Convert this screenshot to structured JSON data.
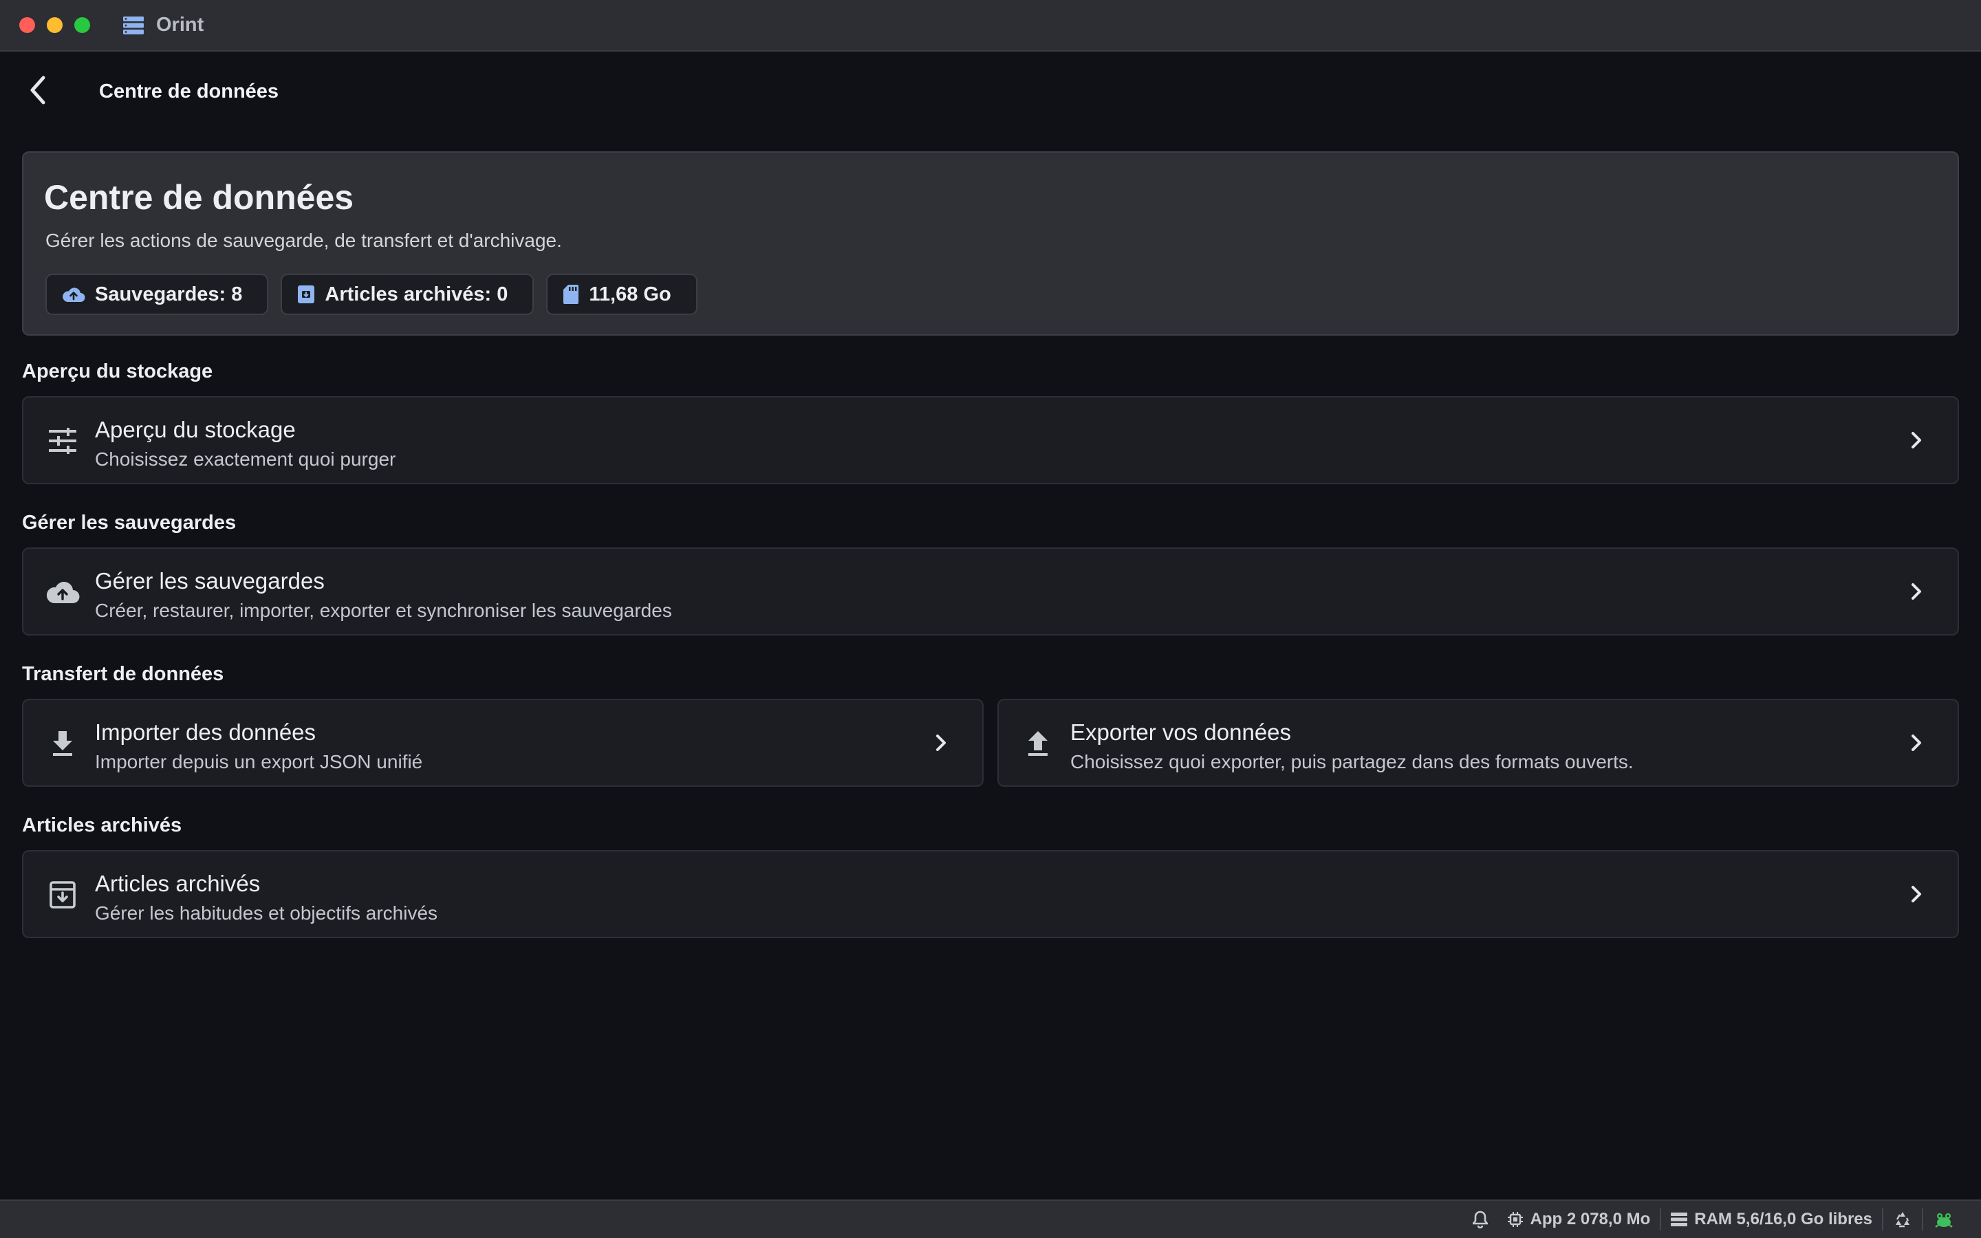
{
  "window": {
    "title": "Orint"
  },
  "nav": {
    "title": "Centre de données"
  },
  "hero": {
    "title": "Centre de données",
    "subtitle": "Gérer les actions de sauvegarde, de transfert et d'archivage.",
    "chips": [
      {
        "icon": "cloud-upload-icon",
        "label": "Sauvegardes: 8"
      },
      {
        "icon": "archive-box-icon",
        "label": "Articles archivés: 0"
      },
      {
        "icon": "sd-card-icon",
        "label": "11,68 Go"
      }
    ]
  },
  "sections": {
    "storage": {
      "label": "Aperçu du stockage",
      "card": {
        "icon": "sliders-icon",
        "title": "Aperçu du stockage",
        "subtitle": "Choisissez exactement quoi purger"
      }
    },
    "backups": {
      "label": "Gérer les sauvegardes",
      "card": {
        "icon": "cloud-upload-icon",
        "title": "Gérer les sauvegardes",
        "subtitle": "Créer, restaurer, importer, exporter et synchroniser les sauvegardes"
      }
    },
    "transfer": {
      "label": "Transfert de données",
      "import": {
        "icon": "download-icon",
        "title": "Importer des données",
        "subtitle": "Importer depuis un export JSON unifié"
      },
      "export": {
        "icon": "upload-icon",
        "title": "Exporter vos données",
        "subtitle": "Choisissez quoi exporter, puis partagez dans des formats ouverts."
      }
    },
    "archived": {
      "label": "Articles archivés",
      "card": {
        "icon": "archive-icon",
        "title": "Articles archivés",
        "subtitle": "Gérer les habitudes et objectifs archivés"
      }
    }
  },
  "statusbar": {
    "app_memory": "App 2 078,0 Mo",
    "ram": "RAM 5,6/16,0 Go libres"
  },
  "colors": {
    "background": "#0f1116",
    "card": "#1b1d22",
    "hero": "#2e3035",
    "accent_icon": "#8fb4f0",
    "status_green": "#3fbf5a"
  }
}
